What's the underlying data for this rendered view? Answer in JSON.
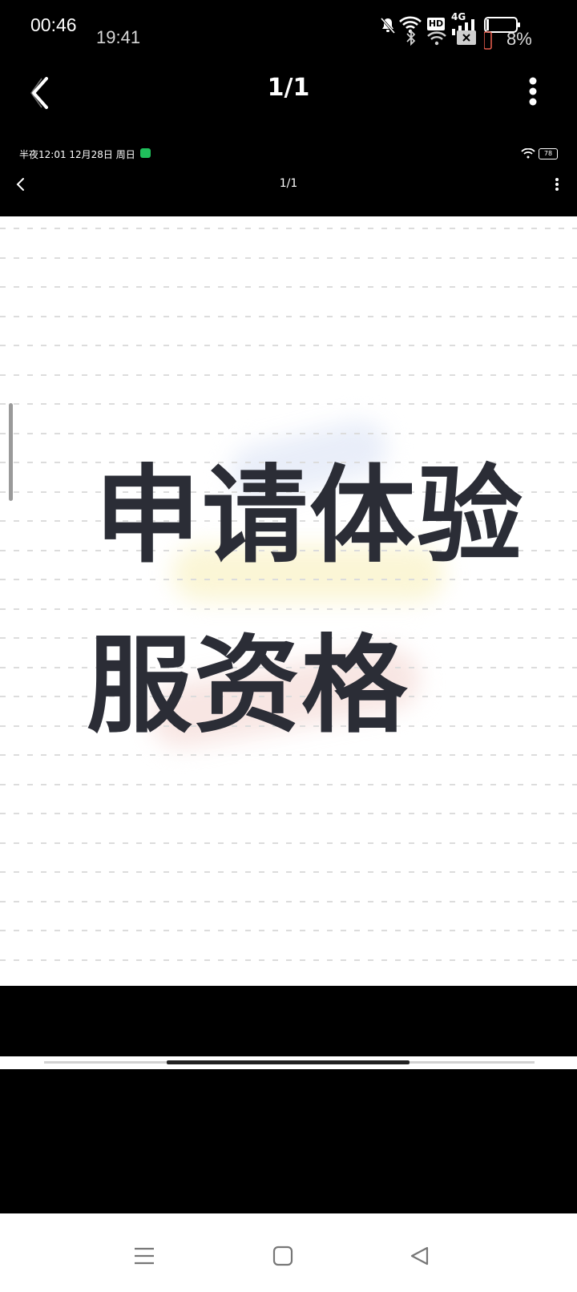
{
  "outer_status": {
    "time": "00:46",
    "ghost_time": "19:41",
    "battery_text": "8%",
    "network_label": "4G",
    "hd_label": "HD",
    "icons": [
      "bell-off-icon",
      "wifi-icon",
      "bluetooth-icon",
      "hd-icon",
      "signal-icon",
      "sim-x-icon",
      "battery-icon"
    ]
  },
  "viewer_header": {
    "page_indicator": "1/1",
    "back_icon": "chevron-left-icon",
    "more_icon": "more-vertical-icon"
  },
  "inner_status": {
    "text": "半夜12:01  12月28日 周日",
    "battery_text": "78",
    "app_icon": "wechat-icon"
  },
  "inner_header": {
    "page_indicator": "1/1"
  },
  "content": {
    "line1": "申请体验",
    "line2": "服资格",
    "highlight_colors": [
      "#e9eef9",
      "#fbf6d6",
      "#f8e6e3"
    ]
  },
  "progress": {
    "fraction_start": 0.25,
    "fraction_end": 0.745
  },
  "navbar": {
    "icons": [
      "menu-icon",
      "home-square-icon",
      "back-triangle-icon"
    ]
  }
}
